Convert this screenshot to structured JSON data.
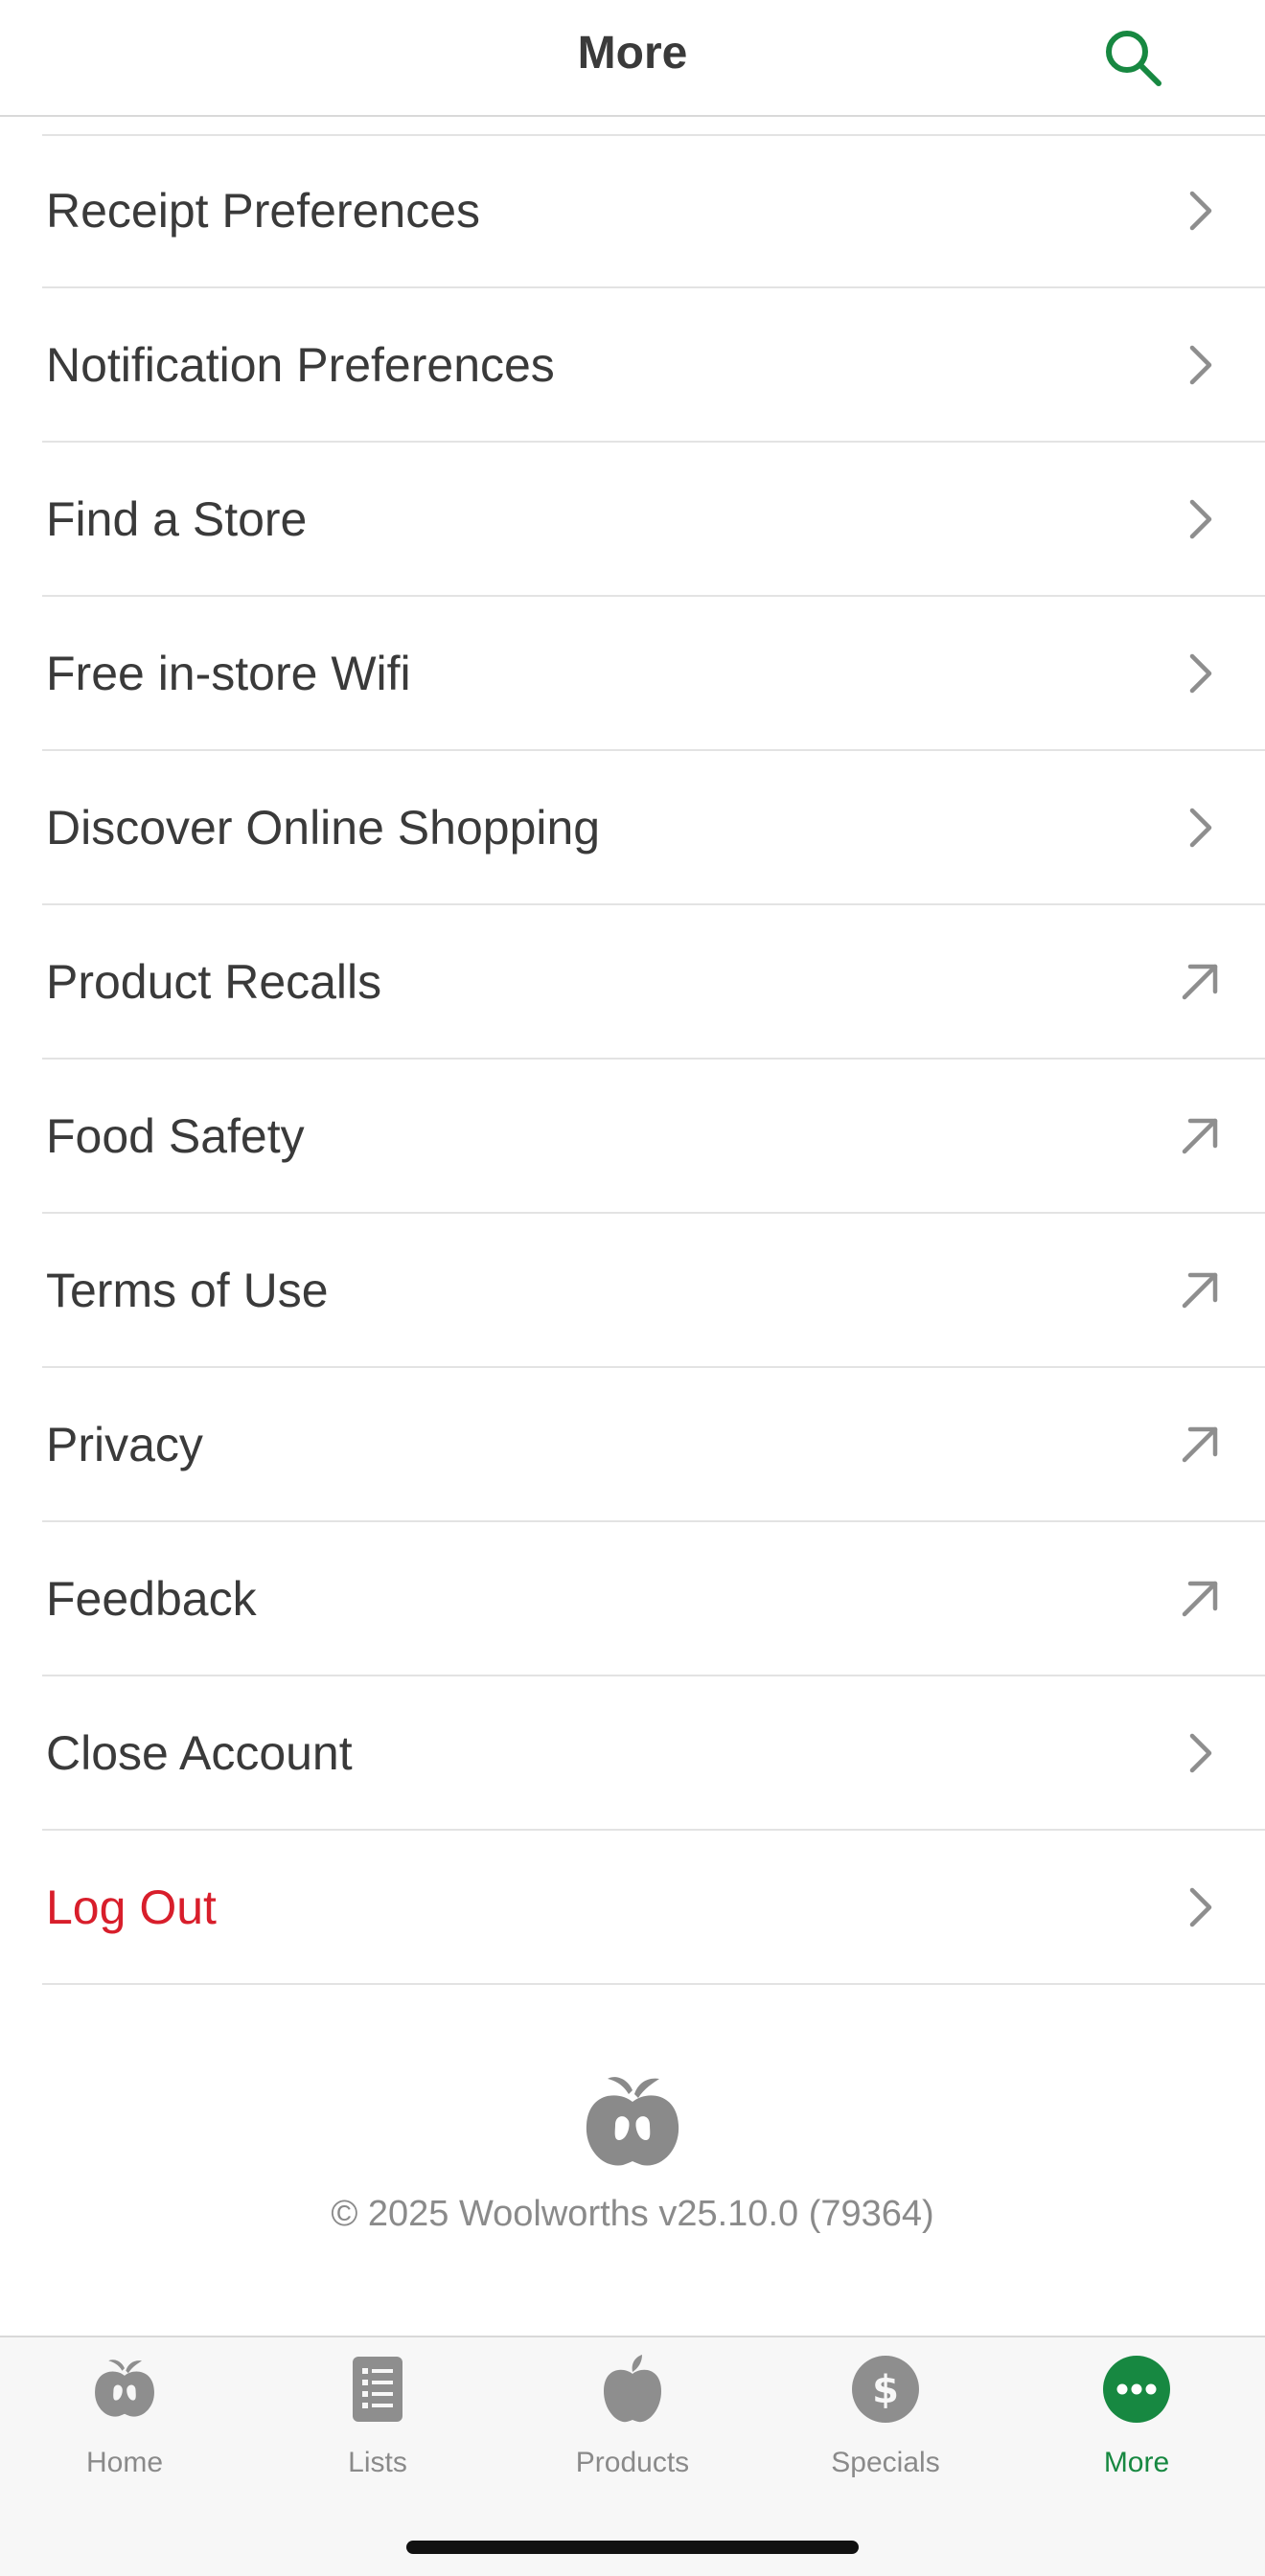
{
  "header": {
    "title": "More",
    "search_icon": "search-icon"
  },
  "menu": {
    "items": [
      {
        "label": "Receipt Preferences",
        "icon": "chevron-right-icon"
      },
      {
        "label": "Notification Preferences",
        "icon": "chevron-right-icon"
      },
      {
        "label": "Find a Store",
        "icon": "chevron-right-icon"
      },
      {
        "label": "Free in-store Wifi",
        "icon": "chevron-right-icon"
      },
      {
        "label": "Discover Online Shopping",
        "icon": "chevron-right-icon"
      },
      {
        "label": "Product Recalls",
        "icon": "external-link-icon"
      },
      {
        "label": "Food Safety",
        "icon": "external-link-icon"
      },
      {
        "label": "Terms of Use",
        "icon": "external-link-icon"
      },
      {
        "label": "Privacy",
        "icon": "external-link-icon"
      },
      {
        "label": "Feedback",
        "icon": "external-link-icon"
      },
      {
        "label": "Close Account",
        "icon": "chevron-right-icon"
      },
      {
        "label": "Log Out",
        "icon": "chevron-right-icon"
      }
    ]
  },
  "footer": {
    "logo_icon": "woolworths-logo-icon",
    "copyright": "© 2025 Woolworths v25.10.0 (79364)"
  },
  "tabbar": {
    "tabs": [
      {
        "label": "Home",
        "icon": "woolworths-logo-icon"
      },
      {
        "label": "Lists",
        "icon": "list-icon"
      },
      {
        "label": "Products",
        "icon": "apple-icon"
      },
      {
        "label": "Specials",
        "icon": "dollar-icon"
      },
      {
        "label": "More",
        "icon": "more-dots-icon",
        "active": true
      }
    ]
  },
  "colors": {
    "accent_green": "#178841",
    "danger_red": "#d81e2b",
    "text": "#3a3a3a",
    "muted": "#8a8a8a",
    "icon_grey": "#8e8e8e"
  }
}
